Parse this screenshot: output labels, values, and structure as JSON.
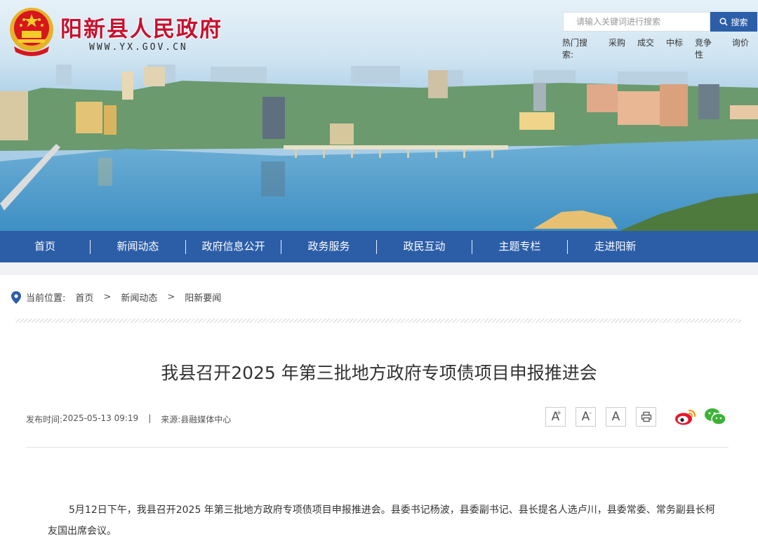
{
  "header": {
    "site_title": "阳新县人民政府",
    "site_url": "WWW.YX.GOV.CN",
    "search_placeholder": "请输入关键词进行搜索",
    "search_button": "搜索",
    "hot_label": "热门搜索:",
    "hot_terms": [
      "采购",
      "成交",
      "中标",
      "竞争性",
      "询价"
    ]
  },
  "nav": {
    "items": [
      "首页",
      "新闻动态",
      "政府信息公开",
      "政务服务",
      "政民互动",
      "主题专栏",
      "走进阳新"
    ]
  },
  "breadcrumb": {
    "label": "当前位置:",
    "items": [
      "首页",
      "新闻动态",
      "阳新要闻"
    ],
    "separator": ">"
  },
  "article": {
    "title": "我县召开2025 年第三批地方政府专项债项目申报推进会",
    "publish_label": "发布时间:",
    "publish_time": "2025-05-13 09:19",
    "divider": "|",
    "source_label": "来源:",
    "source": "县融媒体中心",
    "paragraph1": "5月12日下午，我县召开2025 年第三批地方政府专项债项目申报推进会。县委书记杨波，县委副书记、县长提名人选卢川，县委常委、常务副县长柯友国出席会议。"
  },
  "tools": {
    "font_large": "A",
    "font_large_mark": "+",
    "font_small": "A",
    "font_small_mark": "-",
    "font_default": "A"
  },
  "colors": {
    "nav_bg": "#2c5ea8",
    "title_red": "#c8102e",
    "page_bg": "#f0f2f5"
  },
  "icons": [
    "emblem-icon",
    "search-icon",
    "location-pin-icon",
    "print-icon",
    "weibo-icon",
    "wechat-icon"
  ]
}
